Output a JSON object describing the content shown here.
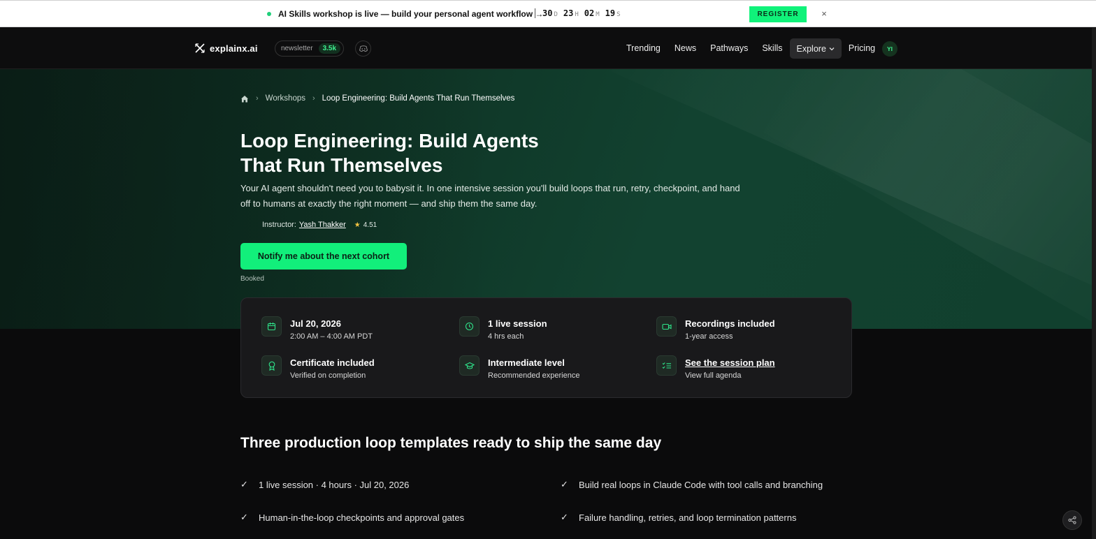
{
  "announcement": {
    "message": "AI Skills workshop is live — build your personal agent workflow →",
    "timer": [
      {
        "value": "30",
        "unit": "D"
      },
      {
        "value": "23",
        "unit": "H"
      },
      {
        "value": "02",
        "unit": "M"
      },
      {
        "value": "19",
        "unit": "S"
      }
    ],
    "register_label": "REGISTER",
    "close_icon": "×"
  },
  "nav": {
    "brand": "explainx.ai",
    "newsletter_label": "newsletter",
    "newsletter_count": "3.5k",
    "links": [
      "Trending",
      "News",
      "Pathways",
      "Skills",
      "Explore",
      "Pricing"
    ],
    "explore_caret": "⌄",
    "avatar_initials": "YI",
    "accent": "#12ef7b"
  },
  "breadcrumb": {
    "items": [
      "Workshops",
      "Loop Engineering: Build Agents That Run Themselves"
    ],
    "separator": "›"
  },
  "hero": {
    "title": "Loop Engineering: Build Agents That Run Themselves",
    "description": "Your AI agent shouldn't need you to babysit it. In one intensive session you'll build loops that run, retry, checkpoint, and hand off to humans at exactly the right moment — and ship them the same day.",
    "instructor_label": "Instructor:",
    "instructor_name": "Yash Thakker",
    "rating_star": "★",
    "rating": "4.51",
    "cta_label": "Notify me about the next cohort",
    "booked_label": "Booked"
  },
  "details": [
    {
      "icon": "calendar-icon",
      "title": "Jul 20, 2026",
      "subtitle": "2:00 AM – 4:00 AM PDT"
    },
    {
      "icon": "clock-icon",
      "title": "1 live session",
      "subtitle": "4 hrs each"
    },
    {
      "icon": "video-icon",
      "title": "Recordings included",
      "subtitle": "1-year access"
    },
    {
      "icon": "award-icon",
      "title": "Certificate included",
      "subtitle": "Verified on completion"
    },
    {
      "icon": "graduation-cap-icon",
      "title": "Intermediate level",
      "subtitle": "Recommended experience"
    },
    {
      "icon": "list-checks-icon",
      "title": "See the session plan",
      "subtitle": "View full agenda"
    }
  ],
  "features": {
    "title": "Three production loop templates ready to ship the same day",
    "check_glyph": "✓",
    "items": [
      "1 live session · 4 hours · Jul 20, 2026",
      "Build real loops in Claude Code with tool calls and branching",
      "Human-in-the-loop checkpoints and approval gates",
      "Failure handling, retries, and loop termination patterns"
    ]
  }
}
